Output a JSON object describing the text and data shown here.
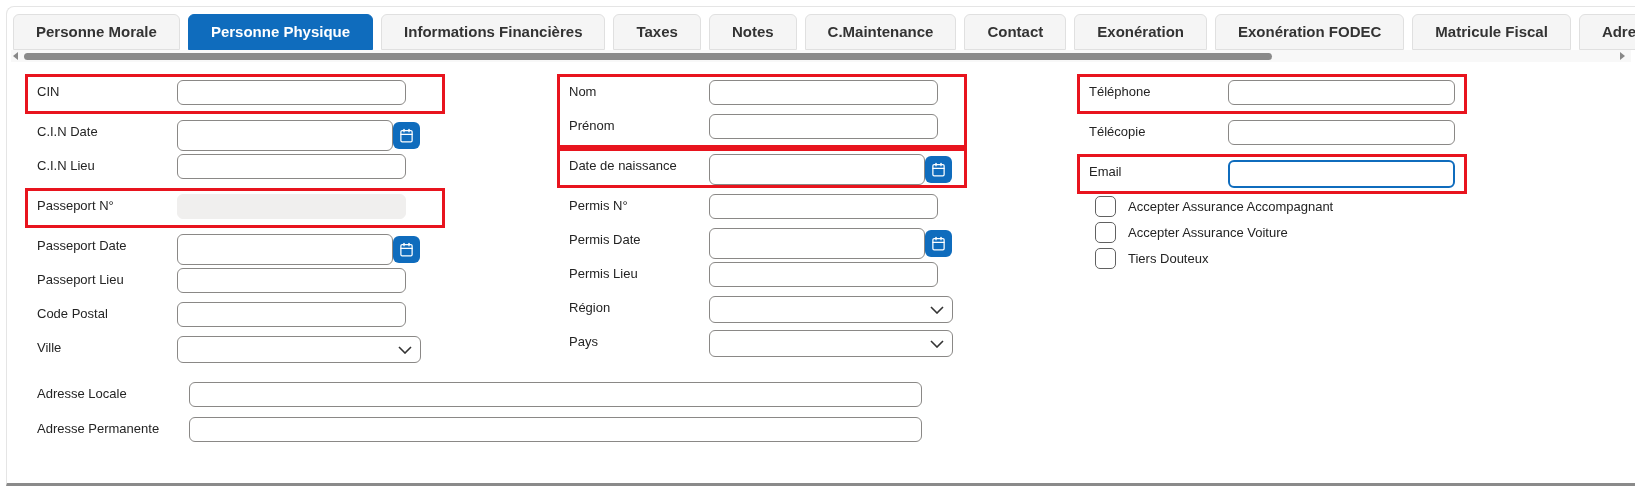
{
  "tabs": [
    {
      "label": "Personne Morale",
      "selected": false
    },
    {
      "label": "Personne Physique",
      "selected": true
    },
    {
      "label": "Informations Financières",
      "selected": false
    },
    {
      "label": "Taxes",
      "selected": false
    },
    {
      "label": "Notes",
      "selected": false
    },
    {
      "label": "C.Maintenance",
      "selected": false
    },
    {
      "label": "Contact",
      "selected": false
    },
    {
      "label": "Exonération",
      "selected": false
    },
    {
      "label": "Exonération FODEC",
      "selected": false
    },
    {
      "label": "Matricule Fiscal",
      "selected": false
    },
    {
      "label": "Adre",
      "selected": false
    }
  ],
  "columns": [
    {
      "blocks": [
        {
          "highlighted": true,
          "fields": [
            {
              "label": "CIN",
              "kind": "text",
              "disabled": false,
              "focused": false
            }
          ]
        },
        {
          "highlighted": false,
          "fields": [
            {
              "label": "C.I.N Date",
              "kind": "date",
              "disabled": false,
              "focused": false
            },
            {
              "label": "C.I.N Lieu",
              "kind": "text",
              "disabled": false,
              "focused": false
            }
          ]
        },
        {
          "highlighted": true,
          "fields": [
            {
              "label": "Passeport N°",
              "kind": "text",
              "disabled": true,
              "focused": false
            }
          ]
        },
        {
          "highlighted": false,
          "fields": [
            {
              "label": "Passeport Date",
              "kind": "date",
              "disabled": false,
              "focused": false
            },
            {
              "label": "Passeport Lieu",
              "kind": "text",
              "disabled": false,
              "focused": false
            },
            {
              "label": "Code Postal",
              "kind": "text",
              "disabled": false,
              "focused": false
            },
            {
              "label": "Ville",
              "kind": "select",
              "disabled": false,
              "focused": false
            }
          ]
        }
      ]
    },
    {
      "blocks": [
        {
          "highlighted": true,
          "fields": [
            {
              "label": "Nom",
              "kind": "text",
              "disabled": false,
              "focused": false
            },
            {
              "label": "Prénom",
              "kind": "text",
              "disabled": false,
              "focused": false
            }
          ]
        },
        {
          "highlighted": true,
          "fields": [
            {
              "label": "Date de naissance",
              "kind": "date",
              "disabled": false,
              "focused": false
            }
          ]
        },
        {
          "highlighted": false,
          "fields": [
            {
              "label": "Permis N°",
              "kind": "text",
              "disabled": false,
              "focused": false
            },
            {
              "label": "Permis Date",
              "kind": "date",
              "disabled": false,
              "focused": false
            },
            {
              "label": "Permis Lieu",
              "kind": "text",
              "disabled": false,
              "focused": false
            },
            {
              "label": "Région",
              "kind": "select",
              "disabled": false,
              "focused": false
            },
            {
              "label": "Pays",
              "kind": "select",
              "disabled": false,
              "focused": false
            }
          ]
        }
      ]
    },
    {
      "blocks": [
        {
          "highlighted": true,
          "fields": [
            {
              "label": "Téléphone",
              "kind": "text",
              "disabled": false,
              "focused": false
            }
          ]
        },
        {
          "highlighted": false,
          "fields": [
            {
              "label": "Télécopie",
              "kind": "text",
              "disabled": false,
              "focused": false
            }
          ]
        },
        {
          "highlighted": true,
          "fields": [
            {
              "label": "Email",
              "kind": "text",
              "disabled": false,
              "focused": true
            }
          ]
        }
      ],
      "checkboxes": [
        {
          "label": "Accepter Assurance Accompagnant",
          "checked": false
        },
        {
          "label": "Accepter Assurance Voiture",
          "checked": false
        },
        {
          "label": "Tiers Douteux",
          "checked": false
        }
      ]
    }
  ],
  "address_fields": [
    {
      "label": "Adresse Locale"
    },
    {
      "label": "Adresse Permanente"
    }
  ]
}
